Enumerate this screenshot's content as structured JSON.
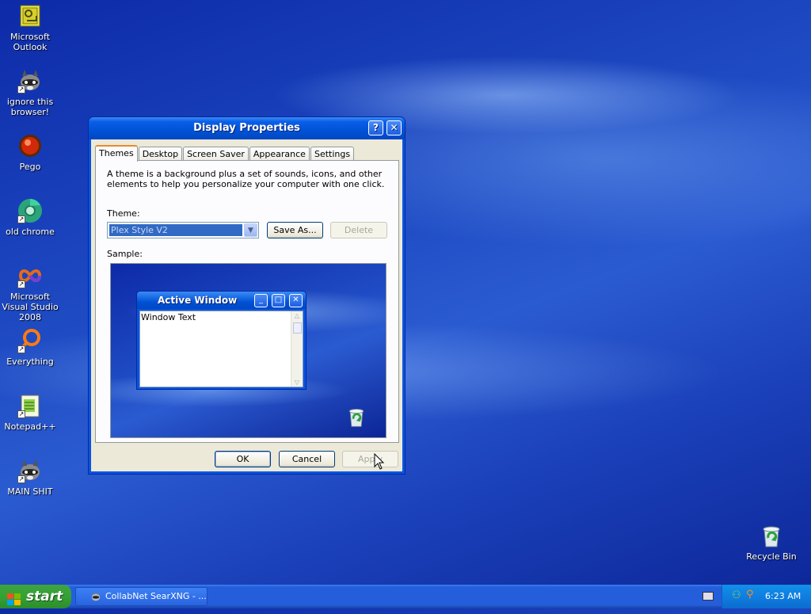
{
  "desktop": {
    "icons": [
      {
        "label": "Microsoft Outlook",
        "icon": "outlook-icon"
      },
      {
        "label": "ignore this browser!",
        "icon": "raccoon-icon"
      },
      {
        "label": "Pego",
        "icon": "pego-icon"
      },
      {
        "label": "old chrome",
        "icon": "chrome-icon"
      },
      {
        "label": "Microsoft Visual Studio 2008",
        "icon": "visual-studio-icon"
      },
      {
        "label": "Everything",
        "icon": "everything-icon"
      },
      {
        "label": "Notepad++",
        "icon": "notepadpp-icon"
      },
      {
        "label": "MAIN SHIT",
        "icon": "raccoon-icon"
      },
      {
        "label": "Recycle Bin",
        "icon": "recycle-bin-icon"
      }
    ]
  },
  "dialog": {
    "title": "Display Properties",
    "help_glyph": "?",
    "close_glyph": "✕",
    "tabs": [
      "Themes",
      "Desktop",
      "Screen Saver",
      "Appearance",
      "Settings"
    ],
    "active_tab": "Themes",
    "description": "A theme is a background plus a set of sounds, icons, and other elements to help you personalize your computer with one click.",
    "theme_label": "Theme:",
    "theme_value": "Plex Style V2",
    "save_as_label": "Save As...",
    "delete_label": "Delete",
    "sample_label": "Sample:",
    "sample": {
      "window_title": "Active Window",
      "window_text": "Window Text"
    },
    "ok_label": "OK",
    "cancel_label": "Cancel",
    "apply_label": "Apply"
  },
  "taskbar": {
    "start_label": "start",
    "task": "CollabNet SearXNG - ...",
    "clock": "6:23 AM"
  },
  "colors": {
    "xp_blue": "#0a54e0",
    "start_green": "#35a134",
    "tray_blue": "#0f7ee0",
    "dialog_face": "#ece9d8"
  }
}
